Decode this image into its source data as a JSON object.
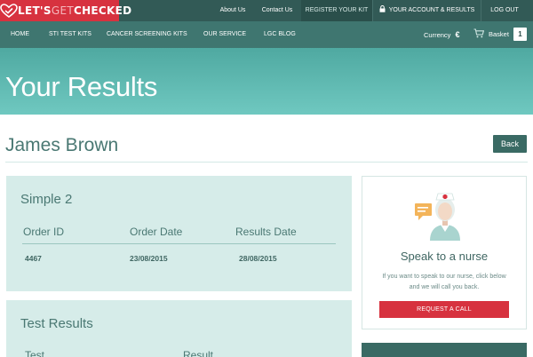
{
  "brand": {
    "name_part1": "LET'S",
    "name_part2": "GET",
    "name_part3": "CHECKED",
    "accent": "#d7323f",
    "teal": "#3f7670"
  },
  "topbar": {
    "about": "About Us",
    "contact": "Contact Us",
    "register": "REGISTER YOUR KIT",
    "account": "YOUR ACCOUNT & RESULTS",
    "logout": "LOG OUT"
  },
  "nav": {
    "items": [
      "HOME",
      "STI TEST KITS",
      "CANCER SCREENING KITS",
      "OUR SERVICE",
      "LGC BLOG"
    ],
    "currency_label": "Currency",
    "currency_symbol": "€",
    "basket_label": "Basket",
    "basket_count": "1"
  },
  "hero": {
    "title": "Your Results"
  },
  "patient": {
    "name": "James Brown",
    "back_label": "Back"
  },
  "order": {
    "title": "Simple 2",
    "headers": [
      "Order ID",
      "Order Date",
      "Results Date"
    ],
    "values": [
      "4467",
      "23/08/2015",
      "28/08/2015"
    ]
  },
  "results": {
    "title": "Test Results",
    "headers": [
      "Test",
      "Result"
    ]
  },
  "nurse": {
    "title": "Speak to a nurse",
    "text": "If you want to speak to our nurse, click below and we will call you back.",
    "button": "REQUEST A CALL"
  },
  "icons": {
    "logo": "heart-check-icon",
    "account": "lock-icon",
    "basket": "basket-icon",
    "nurse": "nurse-icon",
    "chat": "speech-bubble-icon"
  }
}
